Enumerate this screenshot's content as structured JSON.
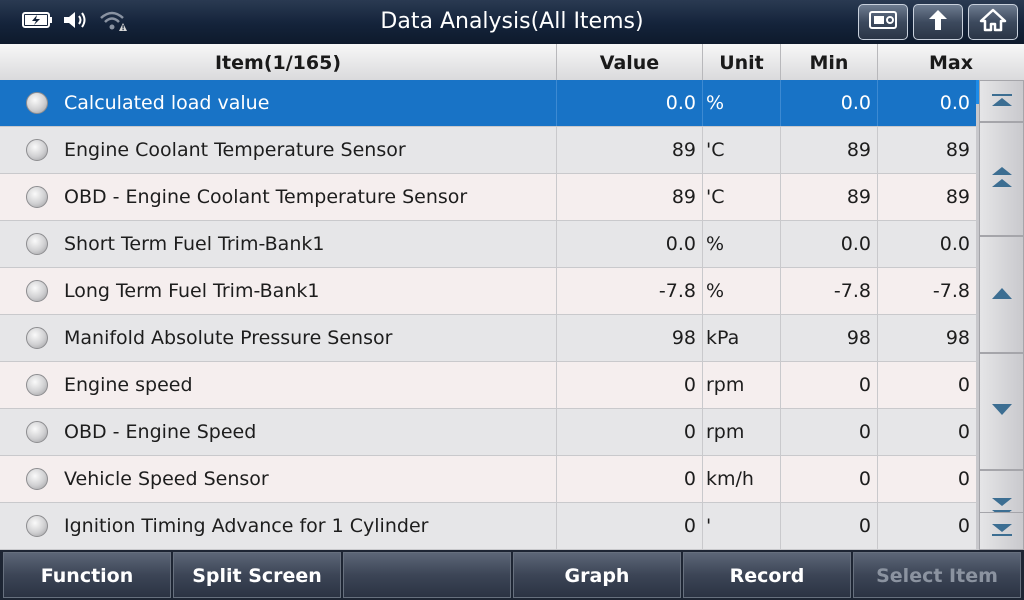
{
  "header": {
    "title": "Data Analysis(All Items)",
    "icons": [
      "battery-icon",
      "volume-icon",
      "wifi-warning-icon",
      "screenshot-icon",
      "back-icon",
      "home-icon"
    ]
  },
  "table": {
    "columns": {
      "item": "Item(1/165)",
      "value": "Value",
      "unit": "Unit",
      "min": "Min",
      "max": "Max"
    },
    "rows": [
      {
        "item": "Calculated load value",
        "value": "0.0",
        "unit": "%",
        "min": "0.0",
        "max": "0.0"
      },
      {
        "item": "Engine Coolant Temperature Sensor",
        "value": "89",
        "unit": "'C",
        "min": "89",
        "max": "89"
      },
      {
        "item": "OBD - Engine Coolant Temperature Sensor",
        "value": "89",
        "unit": "'C",
        "min": "89",
        "max": "89"
      },
      {
        "item": "Short Term Fuel Trim-Bank1",
        "value": "0.0",
        "unit": "%",
        "min": "0.0",
        "max": "0.0"
      },
      {
        "item": "Long Term Fuel Trim-Bank1",
        "value": "-7.8",
        "unit": "%",
        "min": "-7.8",
        "max": "-7.8"
      },
      {
        "item": "Manifold Absolute Pressure Sensor",
        "value": "98",
        "unit": "kPa",
        "min": "98",
        "max": "98"
      },
      {
        "item": "Engine speed",
        "value": "0",
        "unit": "rpm",
        "min": "0",
        "max": "0"
      },
      {
        "item": "OBD - Engine Speed",
        "value": "0",
        "unit": "rpm",
        "min": "0",
        "max": "0"
      },
      {
        "item": "Vehicle Speed Sensor",
        "value": "0",
        "unit": "km/h",
        "min": "0",
        "max": "0"
      },
      {
        "item": "Ignition Timing Advance for 1 Cylinder",
        "value": "0",
        "unit": "'",
        "min": "0",
        "max": "0"
      }
    ],
    "selected_row": 0
  },
  "footer": {
    "buttons": [
      "Function",
      "Split Screen",
      "",
      "Graph",
      "Record",
      "Select Item"
    ],
    "disabled": [
      false,
      false,
      false,
      false,
      false,
      true
    ]
  },
  "colors": {
    "selected_row": "#1873c6",
    "header_bg": "#14233a"
  }
}
